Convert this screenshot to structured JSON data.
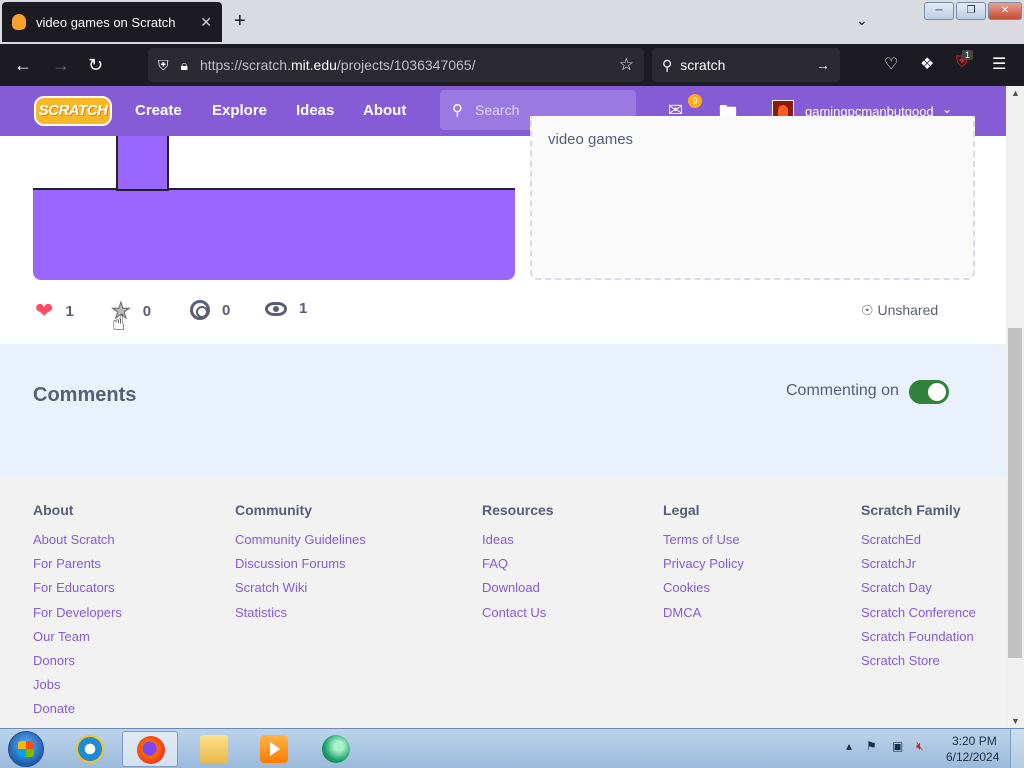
{
  "browser": {
    "tab_title": "video games on Scratch",
    "tab_close": "✕",
    "new_tab": "+",
    "tabs_list": "⌄",
    "url_prefix": "https://scratch.",
    "url_host": "mit.edu",
    "url_path": "/projects/1036347065/",
    "search_query": "scratch",
    "extension_badge": "1"
  },
  "header": {
    "logo_text": "SCRATCH",
    "nav": [
      "Create",
      "Explore",
      "Ideas",
      "About"
    ],
    "search_placeholder": "Search",
    "messages_count": "9",
    "username": "gamingpcmanbutgood"
  },
  "project": {
    "notes_text": "video games",
    "stats": {
      "loves": "1",
      "favorites": "0",
      "remixes": "0",
      "views": "1"
    },
    "unshared_label": "Unshared"
  },
  "comments": {
    "title": "Comments",
    "commenting_label": "Commenting on"
  },
  "footer": {
    "columns": [
      {
        "title": "About",
        "links": [
          "About Scratch",
          "For Parents",
          "For Educators",
          "For Developers",
          "Our Team",
          "Donors",
          "Jobs",
          "Donate"
        ]
      },
      {
        "title": "Community",
        "links": [
          "Community Guidelines",
          "Discussion Forums",
          "Scratch Wiki",
          "Statistics"
        ]
      },
      {
        "title": "Resources",
        "links": [
          "Ideas",
          "FAQ",
          "Download",
          "Contact Us"
        ]
      },
      {
        "title": "Legal",
        "links": [
          "Terms of Use",
          "Privacy Policy",
          "Cookies",
          "DMCA"
        ]
      },
      {
        "title": "Scratch Family",
        "links": [
          "ScratchEd",
          "ScratchJr",
          "Scratch Day",
          "Scratch Conference",
          "Scratch Foundation",
          "Scratch Store"
        ]
      }
    ]
  },
  "taskbar": {
    "time": "3:20 PM",
    "date": "6/12/2024"
  },
  "colors": {
    "scratch_purple": "#855cd6",
    "stage_purple": "#9966ff",
    "toggle_green": "#31803b",
    "love_red": "#ff4d6a"
  }
}
